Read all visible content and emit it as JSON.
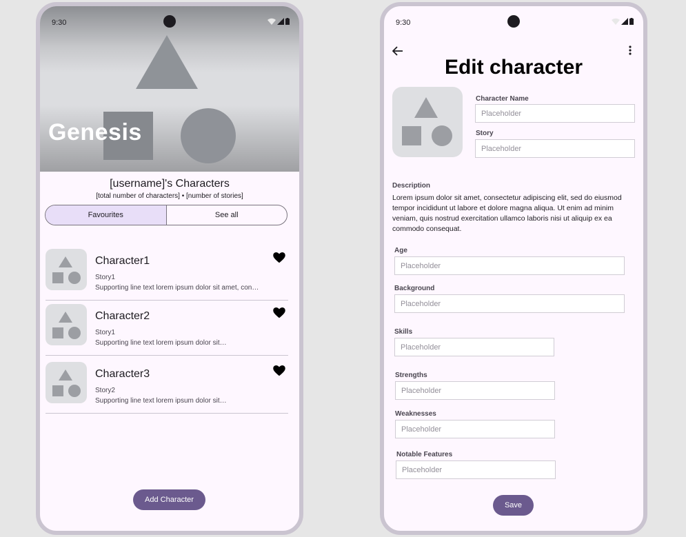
{
  "status_bar": {
    "time": "9:30"
  },
  "home": {
    "hero_title": "Genesis",
    "user_title": "[username]'s Characters",
    "user_subtitle": "[total number of characters]  • [number of stories]",
    "segments": [
      {
        "label": "Favourites",
        "selected": true
      },
      {
        "label": "See all",
        "selected": false
      }
    ],
    "characters": [
      {
        "name": "Character1",
        "story": "Story1",
        "supporting": "Supporting line text lorem ipsum dolor sit amet, consectetur",
        "favourite": true
      },
      {
        "name": "Character2",
        "story": "Story1",
        "supporting": "Supporting line text lorem ipsum dolor sit…",
        "favourite": true
      },
      {
        "name": "Character3",
        "story": "Story2",
        "supporting": "Supporting line text lorem ipsum dolor sit…",
        "favourite": true
      }
    ],
    "add_button": "Add Character"
  },
  "edit": {
    "title": "Edit character",
    "fields": {
      "name": {
        "label": "Character Name",
        "placeholder": "Placeholder"
      },
      "story": {
        "label": "Story",
        "placeholder": "Placeholder"
      },
      "age": {
        "label": "Age",
        "placeholder": "Placeholder"
      },
      "background": {
        "label": "Background",
        "placeholder": "Placeholder"
      },
      "skills": {
        "label": "Skills",
        "placeholder": "Placeholder"
      },
      "strengths": {
        "label": "Strengths",
        "placeholder": "Placeholder"
      },
      "weaknesses": {
        "label": "Weaknesses",
        "placeholder": "Placeholder"
      },
      "notable": {
        "label": "Notable Features",
        "placeholder": "Placeholder"
      }
    },
    "description_label": "Description",
    "description_text": "Lorem ipsum dolor sit amet, consectetur adipiscing elit, sed do eiusmod tempor incididunt ut labore et dolore magna aliqua. Ut enim ad minim veniam, quis nostrud exercitation ullamco laboris nisi ut aliquip ex ea commodo consequat.",
    "save_button": "Save"
  },
  "colors": {
    "primary": "#6b5a8e",
    "surface": "#fef7ff",
    "segment_selected": "#e8def8",
    "placeholder_shape": "#9c9ea3"
  },
  "icons": [
    "wifi-icon",
    "signal-icon",
    "battery-icon",
    "heart-icon",
    "back-arrow-icon",
    "more-vert-icon"
  ]
}
